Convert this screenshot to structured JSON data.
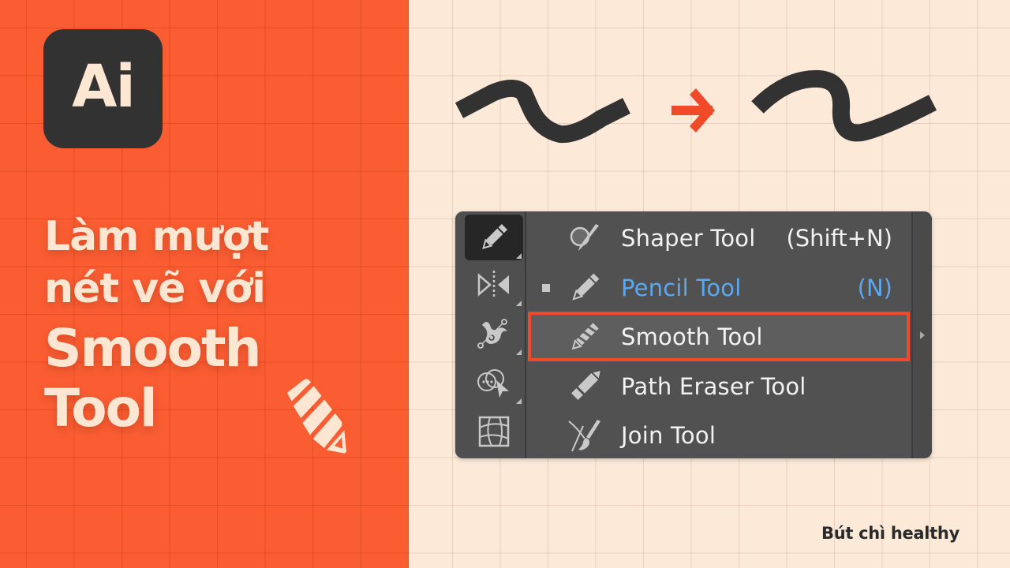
{
  "brand": {
    "logo_text": "Ai",
    "logo_name": "adobe-illustrator-logo",
    "accent_color": "#fa5d32",
    "background_color": "#fde9d8",
    "dark_color": "#323232"
  },
  "headline": {
    "line1": "Làm mượt",
    "line2": "nét vẽ với",
    "line3": "Smooth",
    "line4": "Tool"
  },
  "illustration": {
    "before_label": "rough-stroke",
    "arrow_icon": "arrow-right-icon",
    "after_label": "smooth-stroke"
  },
  "toolbar": {
    "buttons": [
      {
        "name": "pencil-tool-button",
        "icon": "pencil-icon",
        "active": true
      },
      {
        "name": "reflect-tool-button",
        "icon": "reflect-icon",
        "active": false
      },
      {
        "name": "puppet-warp-tool-button",
        "icon": "puppet-warp-icon",
        "active": false
      },
      {
        "name": "shape-builder-tool-button",
        "icon": "shape-builder-icon",
        "active": false
      },
      {
        "name": "mesh-tool-button",
        "icon": "mesh-icon",
        "active": false
      }
    ]
  },
  "tool_menu": {
    "items": [
      {
        "label": "Shaper Tool",
        "shortcut": "(Shift+N)",
        "icon": "shaper-icon",
        "current": false,
        "highlighted": false
      },
      {
        "label": "Pencil Tool",
        "shortcut": "(N)",
        "icon": "pencil-icon",
        "current": true,
        "highlighted": false
      },
      {
        "label": "Smooth Tool",
        "shortcut": "",
        "icon": "smooth-icon",
        "current": false,
        "highlighted": true
      },
      {
        "label": "Path Eraser Tool",
        "shortcut": "",
        "icon": "path-eraser-icon",
        "current": false,
        "highlighted": false
      },
      {
        "label": "Join Tool",
        "shortcut": "",
        "icon": "join-icon",
        "current": false,
        "highlighted": false
      }
    ],
    "current_color": "#5aa8f0",
    "highlight_color": "#f04a28"
  },
  "credit": {
    "text": "Bút chì healthy"
  }
}
